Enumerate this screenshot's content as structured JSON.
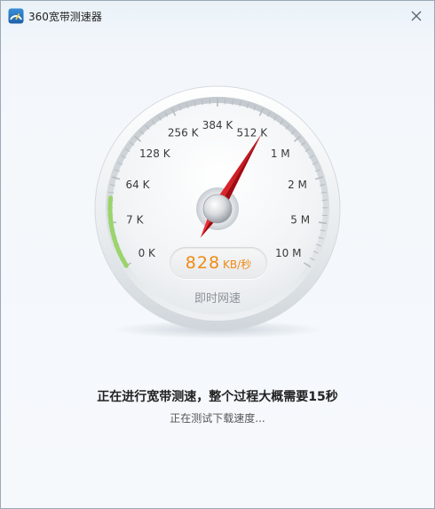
{
  "window": {
    "title": "360宽带测速器",
    "logo_icon": "360-speed-logo-icon",
    "close_icon": "close-icon"
  },
  "gauge": {
    "tick_labels": [
      "0 K",
      "7 K",
      "64 K",
      "128 K",
      "256 K",
      "384 K",
      "512 K",
      "1 M",
      "2 M",
      "5 M",
      "10 M"
    ],
    "speed_value": "828",
    "speed_unit": "KB/秒",
    "caption": "即时网速",
    "needle_position": 6.25,
    "colors": {
      "needle": "#d0121b",
      "speed_text": "#f08a14",
      "progress_arc": "#9bd46b"
    }
  },
  "status": {
    "main": "正在进行宽带测速，整个过程大概需要15秒",
    "sub": "正在测试下载速度..."
  }
}
